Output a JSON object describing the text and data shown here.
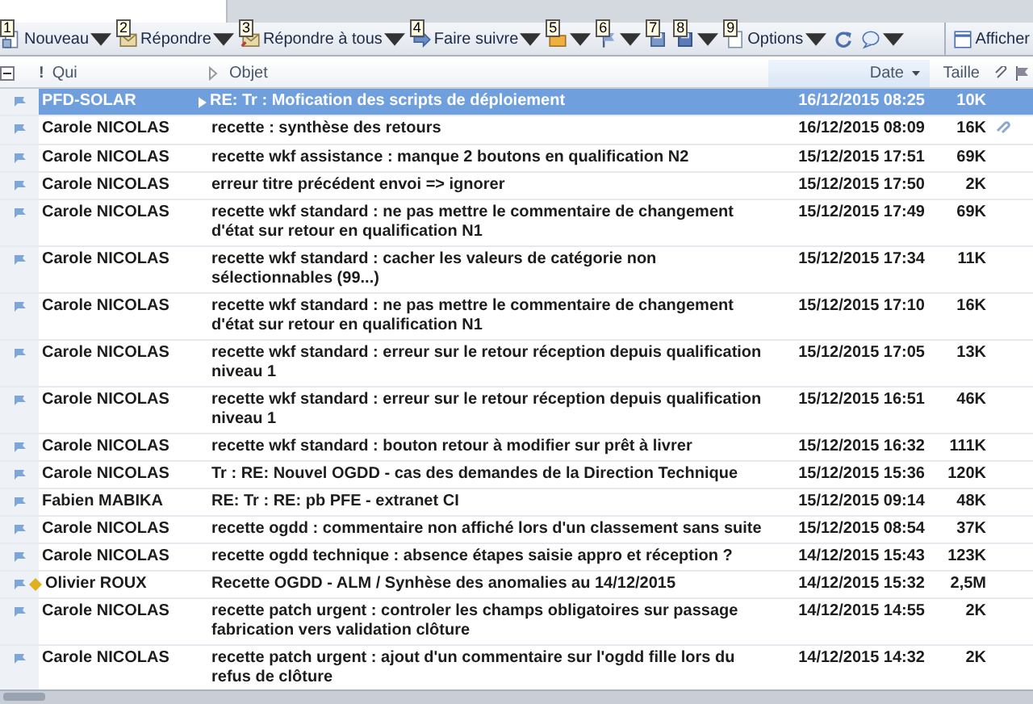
{
  "toolbar": {
    "buttons": [
      {
        "kind": "new",
        "keytip": "1",
        "label": "Nouveau",
        "dropdown": true
      },
      {
        "kind": "reply",
        "keytip": "2",
        "label": "Répondre",
        "dropdown": true
      },
      {
        "kind": "reply-all",
        "keytip": "3",
        "label": "Répondre à tous",
        "dropdown": true
      },
      {
        "kind": "forward",
        "keytip": "4",
        "label": "Faire suivre",
        "dropdown": true
      },
      {
        "kind": "category",
        "keytip": "5",
        "dropdown": true
      },
      {
        "kind": "flag",
        "keytip": "6",
        "dropdown": true
      },
      {
        "kind": "save",
        "keytip": "7",
        "dropdown": false
      },
      {
        "kind": "disk",
        "keytip": "8",
        "dropdown": true
      },
      {
        "kind": "options",
        "keytip": "9",
        "label": "Options",
        "dropdown": true
      },
      {
        "kind": "refresh",
        "dropdown": false
      },
      {
        "kind": "help",
        "dropdown": true
      }
    ],
    "right_button": {
      "label": "Afficher"
    }
  },
  "table": {
    "columns": [
      {
        "label": "!"
      },
      {
        "label": "Qui"
      },
      {
        "label": "Objet"
      },
      {
        "label": "Date",
        "sorted": true
      },
      {
        "label": "Taille"
      }
    ],
    "rows": [
      {
        "from": "PFD-SOLAR",
        "subject": "RE: Tr : Mofication des scripts de déploiement",
        "date": "16/12/2015 08:25",
        "size": "10K",
        "selected": true,
        "attachment": false,
        "marker": false,
        "expandable": true
      },
      {
        "from": "Carole NICOLAS",
        "subject": "recette : synthèse des retours",
        "date": "16/12/2015 08:09",
        "size": "16K",
        "selected": false,
        "attachment": true,
        "marker": false,
        "expandable": false
      },
      {
        "from": "Carole NICOLAS",
        "subject": "recette wkf assistance : manque 2 boutons en qualification N2",
        "date": "15/12/2015 17:51",
        "size": "69K",
        "selected": false,
        "attachment": false,
        "marker": false,
        "expandable": false
      },
      {
        "from": "Carole NICOLAS",
        "subject": "erreur titre précédent envoi => ignorer",
        "date": "15/12/2015 17:50",
        "size": "2K",
        "selected": false,
        "attachment": false,
        "marker": false,
        "expandable": false
      },
      {
        "from": "Carole NICOLAS",
        "subject": "recette wkf standard : ne pas mettre le commentaire de changement d'état sur retour en qualification N1",
        "date": "15/12/2015 17:49",
        "size": "69K",
        "selected": false,
        "attachment": false,
        "marker": false,
        "expandable": false
      },
      {
        "from": "Carole NICOLAS",
        "subject": "recette wkf standard : cacher les valeurs de catégorie non sélectionnables (99...)",
        "date": "15/12/2015 17:34",
        "size": "11K",
        "selected": false,
        "attachment": false,
        "marker": false,
        "expandable": false
      },
      {
        "from": "Carole NICOLAS",
        "subject": "recette wkf standard : ne pas mettre le commentaire de changement d'état sur retour en qualification N1",
        "date": "15/12/2015 17:10",
        "size": "16K",
        "selected": false,
        "attachment": false,
        "marker": false,
        "expandable": false
      },
      {
        "from": "Carole NICOLAS",
        "subject": "recette wkf standard : erreur sur le retour réception depuis qualification niveau 1",
        "date": "15/12/2015 17:05",
        "size": "13K",
        "selected": false,
        "attachment": false,
        "marker": false,
        "expandable": false
      },
      {
        "from": "Carole NICOLAS",
        "subject": "recette wkf standard : erreur sur le retour réception depuis qualification niveau 1",
        "date": "15/12/2015 16:51",
        "size": "46K",
        "selected": false,
        "attachment": false,
        "marker": false,
        "expandable": false
      },
      {
        "from": "Carole NICOLAS",
        "subject": "recette wkf standard : bouton retour à modifier sur prêt à livrer",
        "date": "15/12/2015 16:32",
        "size": "111K",
        "selected": false,
        "attachment": false,
        "marker": false,
        "expandable": false
      },
      {
        "from": "Carole NICOLAS",
        "subject": "Tr : RE: Nouvel OGDD - cas des demandes de la Direction Technique",
        "date": "15/12/2015 15:36",
        "size": "120K",
        "selected": false,
        "attachment": false,
        "marker": false,
        "expandable": false
      },
      {
        "from": "Fabien MABIKA",
        "subject": "RE: Tr : RE: pb PFE - extranet CI",
        "date": "15/12/2015 09:14",
        "size": "48K",
        "selected": false,
        "attachment": false,
        "marker": false,
        "expandable": false
      },
      {
        "from": "Carole NICOLAS",
        "subject": "recette ogdd : commentaire non affiché lors d'un classement sans suite",
        "date": "15/12/2015 08:54",
        "size": "37K",
        "selected": false,
        "attachment": false,
        "marker": false,
        "expandable": false
      },
      {
        "from": "Carole NICOLAS",
        "subject": "recette ogdd technique : absence étapes saisie appro et réception ?",
        "date": "14/12/2015 15:43",
        "size": "123K",
        "selected": false,
        "attachment": false,
        "marker": false,
        "expandable": false
      },
      {
        "from": "Olivier ROUX",
        "subject": "Recette OGDD - ALM / Synhèse des anomalies au 14/12/2015",
        "date": "14/12/2015 15:32",
        "size": "2,5M",
        "selected": false,
        "attachment": false,
        "marker": true,
        "expandable": false
      },
      {
        "from": "Carole NICOLAS",
        "subject": "recette patch urgent : controler les champs obligatoires sur passage fabrication vers validation clôture",
        "date": "14/12/2015 14:55",
        "size": "2K",
        "selected": false,
        "attachment": false,
        "marker": false,
        "expandable": false
      },
      {
        "from": "Carole NICOLAS",
        "subject": "recette patch urgent : ajout d'un commentaire sur l'ogdd fille lors du refus de clôture",
        "date": "14/12/2015 14:32",
        "size": "2K",
        "selected": false,
        "attachment": false,
        "marker": false,
        "expandable": false
      }
    ]
  }
}
